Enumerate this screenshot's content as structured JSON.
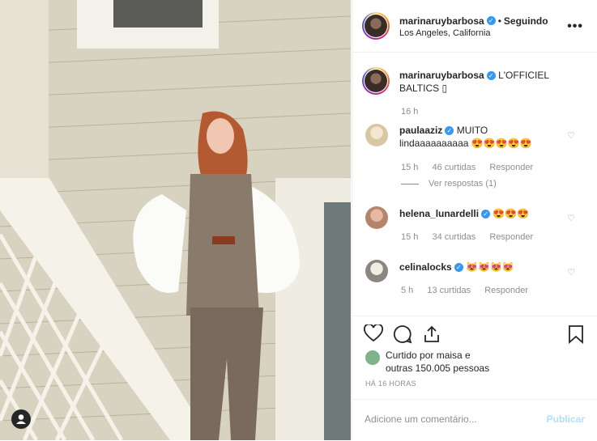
{
  "post": {
    "username": "marinaruybarbosa",
    "follow_state": "Seguindo",
    "separator": "•",
    "location": "Los Angeles, California",
    "more_label": "•••",
    "caption": "L'OFFICIEL BALTICS ▯",
    "caption_time": "16 h"
  },
  "comments": [
    {
      "username": "paulaaziz",
      "text": "MUITO lindaaaaaaaaaa 😍😍😍😍😍",
      "time": "15 h",
      "likes": "46 curtidas",
      "reply": "Responder",
      "view_replies": "Ver respostas (1)"
    },
    {
      "username": "helena_lunardelli",
      "text": "😍😍😍",
      "time": "15 h",
      "likes": "34 curtidas",
      "reply": "Responder"
    },
    {
      "username": "celinalocks",
      "text": "😻😻😻😻",
      "time": "5 h",
      "likes": "13 curtidas",
      "reply": "Responder"
    }
  ],
  "likes": {
    "prefix": "Curtido por ",
    "user": "maisa",
    "middle": " e ",
    "others": "outras 150.005 pessoas"
  },
  "timestamp": "HÁ 16 HORAS",
  "comment_box": {
    "placeholder": "Adicione um comentário...",
    "publish": "Publicar"
  },
  "icons": {
    "verified": "verified-badge-icon",
    "like": "heart-icon",
    "comment": "comment-icon",
    "share": "share-icon",
    "save": "bookmark-icon",
    "user_tag": "user-tag-icon"
  },
  "colors": {
    "accent": "#3897f0",
    "muted": "#8e8e8e",
    "publish_disabled": "#b2dffc"
  }
}
